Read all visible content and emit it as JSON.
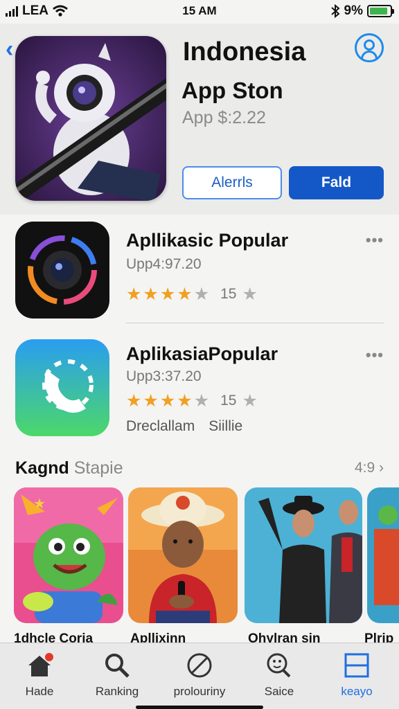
{
  "status_bar": {
    "carrier": "LEA",
    "time": "15 AM",
    "battery_percent": "9%",
    "battery_level": 0.9
  },
  "header": {
    "title": "Indonesia",
    "subtitle": "App Ston",
    "price": "App $:2.22",
    "alerts_button": "Alerrls",
    "fald_button": "Fald"
  },
  "apps": [
    {
      "title": "Apllikasic Popular",
      "sub": "Upp4:97.20",
      "stars_filled": 4,
      "count": "15"
    },
    {
      "title": "AplikasiaPopular",
      "sub": "Upp3:37.20",
      "stars_filled": 4,
      "count": "15",
      "extra": [
        "Dreclallam",
        "Siillie"
      ]
    }
  ],
  "section": {
    "title_bold": "Kagnd",
    "title_light": "Stapie",
    "more": "4:9"
  },
  "tiles": [
    {
      "label": "1dhcle Coria"
    },
    {
      "label": "Apllixinn"
    },
    {
      "label": "Ohylran sin"
    },
    {
      "label": "Plrip"
    }
  ],
  "tabs": [
    {
      "label": "Hade",
      "icon": "home-icon"
    },
    {
      "label": "Ranking",
      "icon": "search-icon"
    },
    {
      "label": "prolouriny",
      "icon": "prohibited-icon"
    },
    {
      "label": "Saice",
      "icon": "search-face-icon"
    },
    {
      "label": "keayo",
      "icon": "grid-icon"
    }
  ],
  "colors": {
    "accent": "#1f6fe0",
    "button_primary": "#1458c8",
    "star": "#f0a022",
    "badge": "#e23a2a"
  }
}
